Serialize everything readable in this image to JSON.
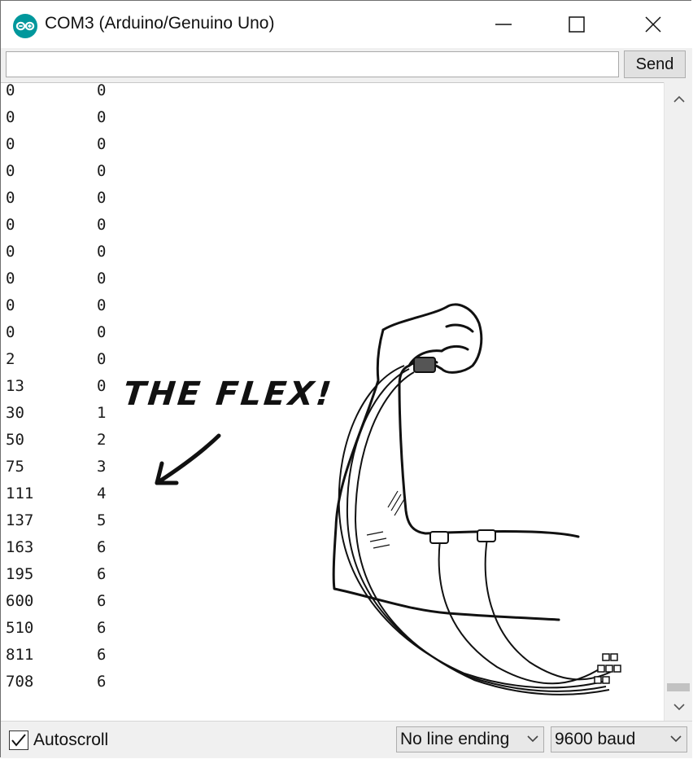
{
  "window": {
    "title": "COM3 (Arduino/Genuino Uno)",
    "app_icon": "arduino-logo-icon",
    "accent_color": "#00979c",
    "controls": [
      "minimize-icon",
      "maximize-icon",
      "close-icon"
    ]
  },
  "send_row": {
    "input_value": "",
    "send_label": "Send"
  },
  "serial_output": [
    [
      "0",
      "0"
    ],
    [
      "0",
      "0"
    ],
    [
      "0",
      "0"
    ],
    [
      "0",
      "0"
    ],
    [
      "0",
      "0"
    ],
    [
      "0",
      "0"
    ],
    [
      "0",
      "0"
    ],
    [
      "0",
      "0"
    ],
    [
      "0",
      "0"
    ],
    [
      "0",
      "0"
    ],
    [
      "2",
      "0"
    ],
    [
      "13",
      "0"
    ],
    [
      "30",
      "1"
    ],
    [
      "50",
      "2"
    ],
    [
      "75",
      "3"
    ],
    [
      "111",
      "4"
    ],
    [
      "137",
      "5"
    ],
    [
      "163",
      "6"
    ],
    [
      "195",
      "6"
    ],
    [
      "600",
      "6"
    ],
    [
      "510",
      "6"
    ],
    [
      "811",
      "6"
    ],
    [
      "708",
      "6"
    ]
  ],
  "annotation": {
    "text": "THE FLEX!",
    "arrow_icon": "hand-drawn-arrow-icon",
    "illustration": "flexed-arm-with-sensors-drawing"
  },
  "bottom_bar": {
    "autoscroll_label": "Autoscroll",
    "autoscroll_checked": true,
    "line_ending_value": "No line ending",
    "baud_value": "9600 baud"
  }
}
